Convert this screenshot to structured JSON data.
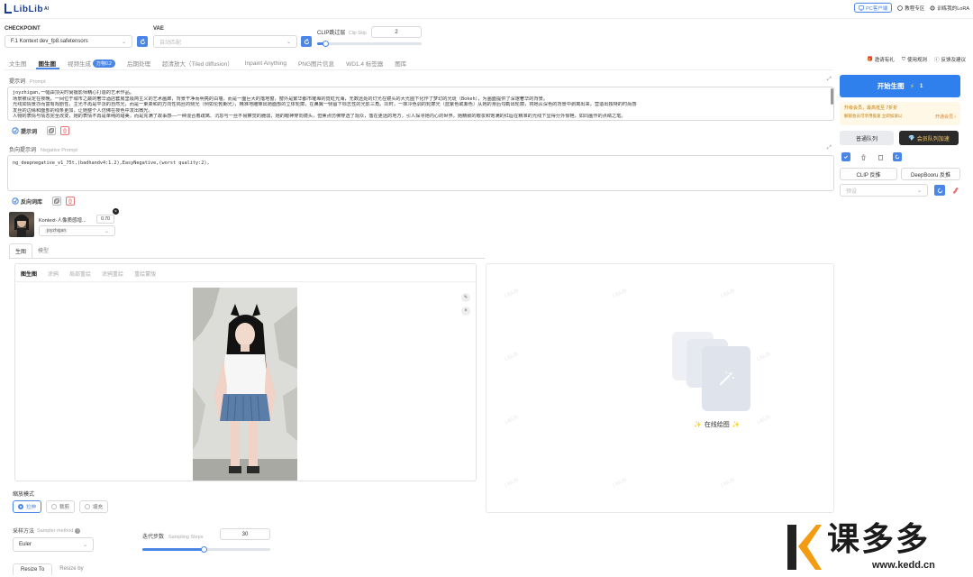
{
  "header": {
    "logo_text": "LibLib",
    "logo_sup": "AI",
    "pc_client_label": "PC客户端",
    "tutorial_label": "教程专区",
    "train_lora_label": "训练我的LoRA"
  },
  "model_bar": {
    "checkpoint_label": "CHECKPOINT",
    "checkpoint_value": "F.1 Kontext dev_fp8.safetensors",
    "vae_label": "VAE",
    "vae_value": "自动匹配",
    "clip_label": "CLIP跳过层",
    "clip_en": "Clip Skip",
    "clip_value": "2",
    "clip_fraction": 0.08
  },
  "main_tabs": [
    {
      "label": "文生图"
    },
    {
      "label": "图生图"
    },
    {
      "label": "视频生成"
    },
    {
      "label": "后期处理"
    },
    {
      "label": "超清放大（Tiled diffusion）"
    },
    {
      "label": "Inpaint Anything"
    },
    {
      "label": "PNG图片信息"
    },
    {
      "label": "WD1.4 标签器"
    },
    {
      "label": "图库"
    }
  ],
  "video_badge": "万物0.2",
  "right_links": {
    "invite": "邀请有礼",
    "rules": "使用规则",
    "feedback": "反馈及建议"
  },
  "prompt": {
    "label": "提示词",
    "label_en": "Prompt",
    "lines": [
      "joyzhigan,一幅由顶尖时尚摄影师精心打造的艺术作品。",
      "场景被设定在夜晚，一间位于城市之巅的奢华酒店套房里极简主义的艺术画廊，背景干净而明亮的白墙，而是一面巨大的落地窗，窗外是繁华都市璀璨的霓虹光海，无数远处的灯光在镜头的大光圈下化作了梦幻的光斑（Bokeh），为画面提供了深邃奢华的背景。",
      "光线如情景亦而富有戏剧性，主光不再是平淡的自然光，而是一束柔和的方向性钨丝的侧光（例如伦勃朗光），精准地雕琢出她面部的立体轮廓，在鼻翼一侧留下标志性的光影三角。同时，一抹冷色调的轮廓光（蓝紫色或紫色）从她的身后勾勒出轮廓，将她从深色的背景中剥离出来，营造出独特的时尚感",
      "发丝的边缘和面部的线条更加，让她整个人仿佛在夜色中发出微光。",
      "人物的表情与情态完全改变，她的表情不再是单纯的甜美，而是充满了故事感——一种混合着疏离、沉思与一丝不易察觉的脆弱，她的眼神穿向镜头，但焦点仿佛穿透了观众，落在更远的地方，引人探寻她内心的世界。她精致的眼妆和饱满的红唇在精准的光线下显得分外惊艳，如同画作的点睛之笔。"
    ],
    "tag_label": "提示词"
  },
  "negative": {
    "label": "负向提示词",
    "label_en": "Negative Prompt",
    "text": "ng_deepnegative_v1_75t,(badhandv4:1.2),EasyNegative,(worst quality:2),",
    "tag_label": "反向词库"
  },
  "lora": {
    "name": "Kontext-人像质感增...",
    "weight": "0.70",
    "trigger": "joyzhigan"
  },
  "sub_tabs": [
    {
      "label": "生图"
    },
    {
      "label": "模型"
    }
  ],
  "img_tabs": [
    {
      "label": "图生图"
    },
    {
      "label": "涂鸦"
    },
    {
      "label": "局部重绘"
    },
    {
      "label": "涂鸦重绘"
    },
    {
      "label": "重绘蒙版"
    }
  ],
  "resize_mode": {
    "label": "缩放模式",
    "options": [
      {
        "label": "拉伸"
      },
      {
        "label": "裁剪"
      },
      {
        "label": "填充"
      }
    ]
  },
  "sampler": {
    "label": "采样方法",
    "label_en": "Sampler method",
    "value": "Euler"
  },
  "steps": {
    "label": "迭代步数",
    "label_en": "Sampling Steps",
    "value": "30",
    "fraction": 0.48
  },
  "resize_tabs": [
    {
      "label": "Resize To"
    },
    {
      "label": "Resize by"
    }
  ],
  "generate": {
    "label": "开始生图",
    "cost": "1"
  },
  "vip": {
    "line1": "升级会员，最高抵至 7折折",
    "line2": "解锁会员可享用极速  立即加速以",
    "link": "开通会员 ›"
  },
  "queue": {
    "normal": "普通队列",
    "vip": "会员队列加速"
  },
  "interrogate": {
    "clip": "CLIP 反推",
    "deepbooru": "DeepBooru 反推"
  },
  "preset_placeholder": "预设",
  "online_draw": "在线绘图",
  "watermark": {
    "brand": "课多多",
    "url": "www.kedd.cn"
  },
  "colors": {
    "accent": "#4a86e8",
    "generate_bg": "#2f80ed",
    "danger": "#e57373",
    "brand_orange": "#f39c12"
  }
}
